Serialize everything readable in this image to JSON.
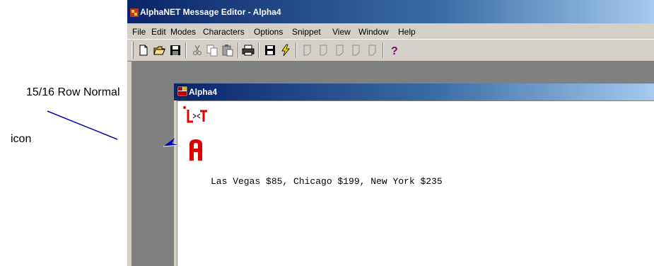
{
  "annotations": {
    "title_label": "15/16 Row Normal",
    "icon_label": "icon"
  },
  "app": {
    "title": "AlphaNET Message Editor - Alpha4",
    "menus": [
      "File",
      "Edit",
      "Modes",
      "Characters",
      "Options",
      "Snippet",
      "View",
      "Window",
      "Help"
    ],
    "toolbar_icons": [
      "new-file-icon",
      "open-folder-icon",
      "save-icon",
      "cut-icon",
      "copy-icon",
      "paste-icon",
      "print-icon",
      "save-disk-icon",
      "send-lightning-icon",
      "page-1-icon",
      "page-2-icon",
      "page-3-icon",
      "page-4-icon",
      "page-5-icon",
      "help-question-icon"
    ]
  },
  "child_window": {
    "title": "Alpha4"
  },
  "editor": {
    "message_text": "Las Vegas $85, Chicago $199, New York $235"
  },
  "colors": {
    "titlebar_start": "#0a246a",
    "titlebar_end": "#a6caf0",
    "control_face": "#d4d0c8",
    "mdi_background": "#808080",
    "marker_red": "#e00000",
    "arrow_blue": "#0000cc"
  }
}
